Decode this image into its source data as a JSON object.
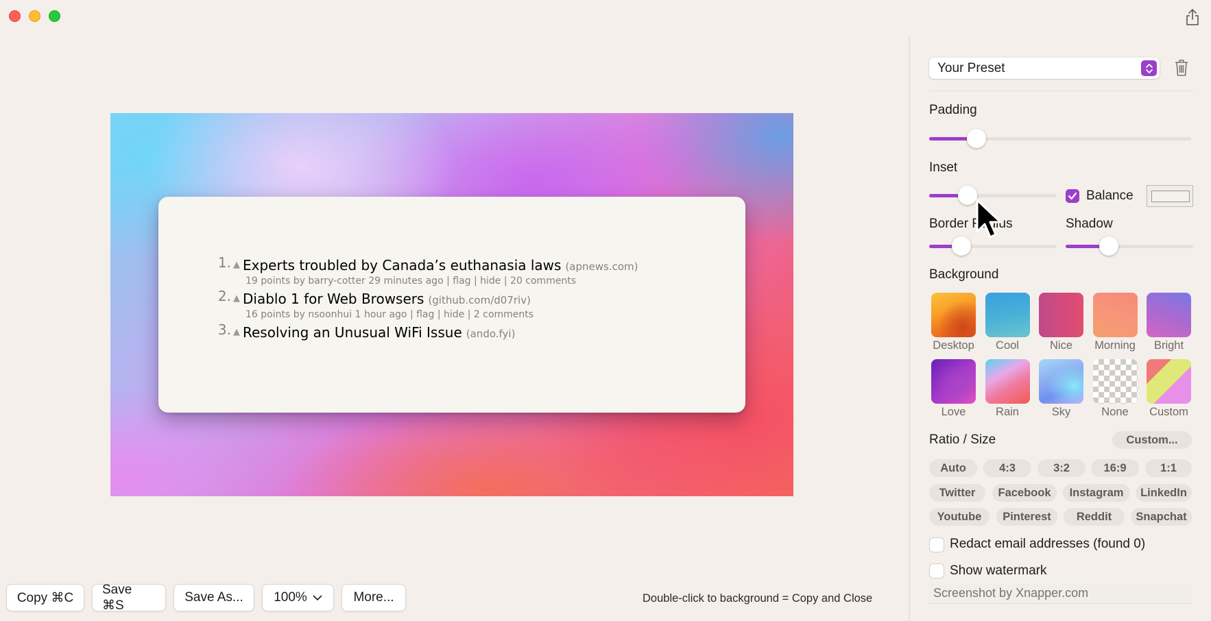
{
  "window": {
    "traffic_lights": [
      "close",
      "minimize",
      "zoom"
    ],
    "share_icon": "share-icon"
  },
  "canvas": {
    "background_preset": "Bright",
    "hn_items": [
      {
        "rank": "1.",
        "title": "Experts troubled by Canada’s euthanasia laws",
        "site": "(apnews.com)",
        "subtext": "19 points by barry-cotter 29 minutes ago | flag | hide | 20 comments"
      },
      {
        "rank": "2.",
        "title": "Diablo 1 for Web Browsers",
        "site": "(github.com/d07riv)",
        "subtext": "16 points by nsoonhui 1 hour ago | flag | hide | 2 comments"
      },
      {
        "rank": "3.",
        "title": "Resolving an Unusual WiFi Issue",
        "site": "(ando.fyi)",
        "subtext": ""
      }
    ]
  },
  "toolbar": {
    "copy_label": "Copy ⌘C",
    "save_label": "Save ⌘S",
    "save_as_label": "Save As...",
    "zoom_label": "100%",
    "more_label": "More...",
    "hint": "Double-click to background = Copy and Close"
  },
  "sidebar": {
    "preset": {
      "value": "Your Preset"
    },
    "padding": {
      "label": "Padding",
      "value_fraction": 0.18
    },
    "inset": {
      "label": "Inset",
      "value_fraction": 0.3
    },
    "balance": {
      "label": "Balance",
      "checked": true
    },
    "border_radius": {
      "label": "Border Radius",
      "value_fraction": 0.25
    },
    "shadow": {
      "label": "Shadow",
      "value_fraction": 0.34
    },
    "background": {
      "label": "Background",
      "options": [
        "Desktop",
        "Cool",
        "Nice",
        "Morning",
        "Bright",
        "Love",
        "Rain",
        "Sky",
        "None",
        "Custom"
      ]
    },
    "ratio": {
      "label": "Ratio / Size",
      "custom_label": "Custom...",
      "rows": [
        [
          "Auto",
          "4:3",
          "3:2",
          "16:9",
          "1:1"
        ],
        [
          "Twitter",
          "Facebook",
          "Instagram",
          "LinkedIn"
        ],
        [
          "Youtube",
          "Pinterest",
          "Reddit",
          "Snapchat"
        ]
      ]
    },
    "redact": {
      "label": "Redact email addresses (found 0)",
      "checked": false
    },
    "watermark": {
      "label": "Show watermark",
      "checked": false,
      "placeholder": "Screenshot by Xnapper.com"
    }
  },
  "accent_color": "#9b3fc9"
}
